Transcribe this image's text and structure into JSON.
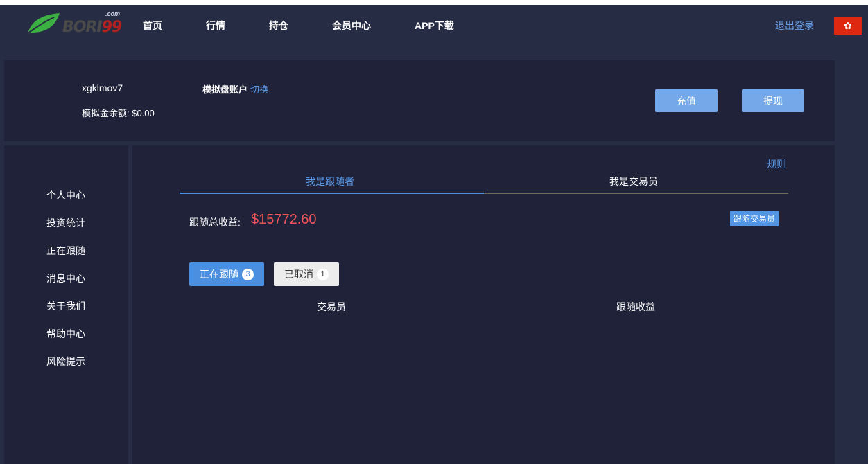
{
  "nav": {
    "logo": {
      "text_main": "BORI",
      "text_num": "99",
      "text_suffix": ".com"
    },
    "items": [
      {
        "label": "首页"
      },
      {
        "label": "行情"
      },
      {
        "label": "持仓"
      },
      {
        "label": "会员中心"
      },
      {
        "label": "APP下载"
      }
    ],
    "logout_label": "退出登录",
    "flag_icon": "hong-kong-flag-icon"
  },
  "account": {
    "username": "xgklmov7",
    "balance_text": "模拟金余额: $0.00",
    "account_type": "模拟盘账户",
    "switch_label": "切换",
    "deposit_label": "充值",
    "withdraw_label": "提现"
  },
  "sidebar": {
    "items": [
      {
        "label": "个人中心"
      },
      {
        "label": "投资统计"
      },
      {
        "label": "正在跟随"
      },
      {
        "label": "消息中心"
      },
      {
        "label": "关于我们"
      },
      {
        "label": "帮助中心"
      },
      {
        "label": "风险提示"
      }
    ]
  },
  "main": {
    "rules_label": "规则",
    "tabs": [
      {
        "label": "我是跟随者",
        "active": true
      },
      {
        "label": "我是交易员",
        "active": false
      }
    ],
    "earnings_label": "跟随总收益:",
    "earnings_value": "$15772.60",
    "follow_trader_label": "跟随交易员",
    "segments": [
      {
        "label": "正在跟随",
        "count": "3"
      },
      {
        "label": "已取消",
        "count": "1"
      }
    ],
    "columns": [
      {
        "label": "交易员"
      },
      {
        "label": "跟随收益"
      }
    ]
  },
  "colors": {
    "background": "#262c43",
    "panel": "#1f2239",
    "accent": "#4a8fe0",
    "earnings": "#f05458"
  }
}
